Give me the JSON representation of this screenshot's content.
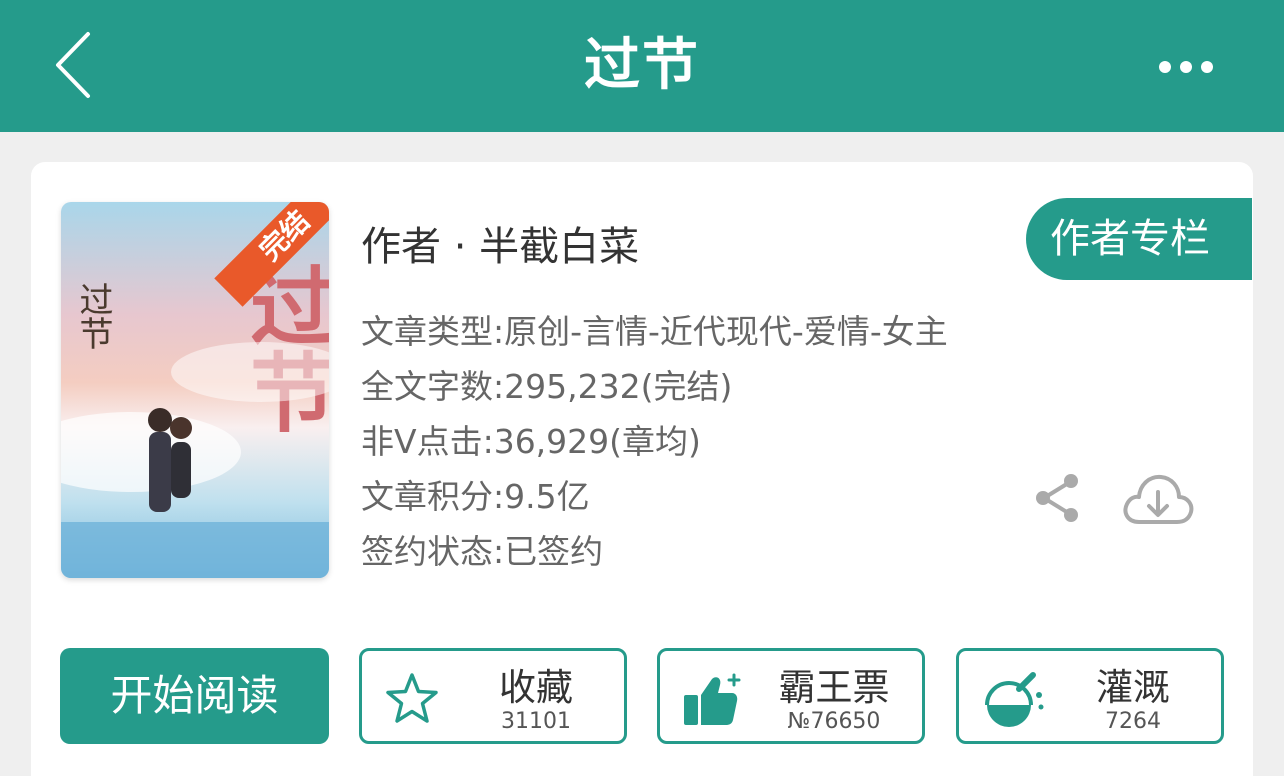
{
  "header": {
    "title": "过节",
    "back_icon": "chevron-left-icon",
    "more_icon": "more-dots-icon"
  },
  "book": {
    "cover": {
      "ribbon": "完结",
      "title_art": "过节",
      "side_art": "过节"
    },
    "author_line": "作者 · 半截白菜",
    "author_column_button": "作者专栏",
    "info_lines": [
      "文章类型:原创-言情-近代现代-爱情-女主",
      "全文字数:295,232(完结)",
      "非V点击:36,929(章均)",
      "文章积分:9.5亿",
      "签约状态:已签约"
    ]
  },
  "actions": {
    "read_button": "开始阅读",
    "favorite": {
      "label": "收藏",
      "count": "31101",
      "icon": "star-icon"
    },
    "ticket": {
      "label": "霸王票",
      "count": "№76650",
      "icon": "thumbs-up-icon"
    },
    "water": {
      "label": "灌溉",
      "count": "7264",
      "icon": "watering-flask-icon"
    }
  },
  "colors": {
    "accent": "#259b8b",
    "background": "#efefef",
    "card": "#ffffff"
  }
}
